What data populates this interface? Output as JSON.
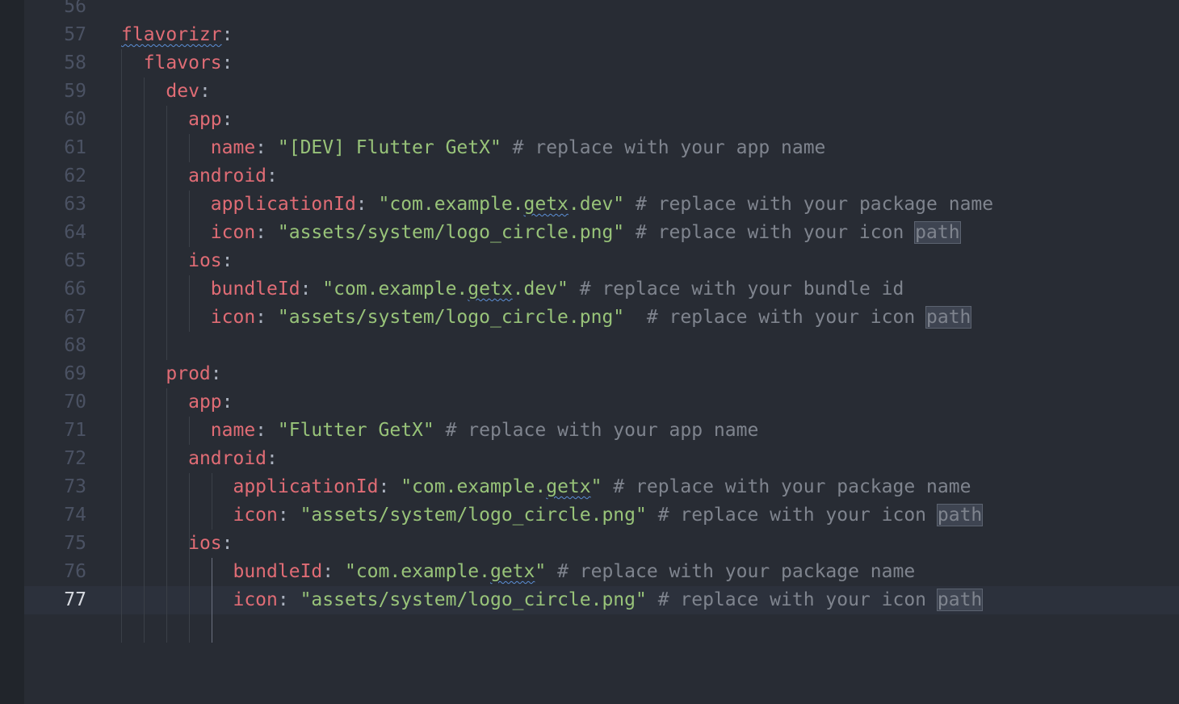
{
  "editor": {
    "lines": [
      {
        "num": "56",
        "tokens": []
      },
      {
        "num": "57",
        "tokens": [
          [
            "key squiggle",
            "flavorizr"
          ],
          [
            "punct",
            ":"
          ]
        ]
      },
      {
        "num": "58",
        "tokens": [
          [
            "",
            "  "
          ],
          [
            "key",
            "flavors"
          ],
          [
            "punct",
            ":"
          ]
        ]
      },
      {
        "num": "59",
        "tokens": [
          [
            "",
            "    "
          ],
          [
            "key",
            "dev"
          ],
          [
            "punct",
            ":"
          ]
        ]
      },
      {
        "num": "60",
        "tokens": [
          [
            "",
            "      "
          ],
          [
            "key",
            "app"
          ],
          [
            "punct",
            ":"
          ]
        ]
      },
      {
        "num": "61",
        "tokens": [
          [
            "",
            "        "
          ],
          [
            "key",
            "name"
          ],
          [
            "punct",
            ": "
          ],
          [
            "str",
            "\"[DEV] Flutter GetX\""
          ],
          [
            "comment",
            " # replace with your app name"
          ]
        ]
      },
      {
        "num": "62",
        "tokens": [
          [
            "",
            "      "
          ],
          [
            "key",
            "android"
          ],
          [
            "punct",
            ":"
          ]
        ]
      },
      {
        "num": "63",
        "tokens": [
          [
            "",
            "        "
          ],
          [
            "key",
            "applicationId"
          ],
          [
            "punct",
            ": "
          ],
          [
            "str",
            "\"com.example."
          ],
          [
            "str squiggle",
            "getx"
          ],
          [
            "str",
            ".dev\""
          ],
          [
            "comment",
            " # replace with your package name"
          ]
        ]
      },
      {
        "num": "64",
        "tokens": [
          [
            "",
            "        "
          ],
          [
            "key",
            "icon"
          ],
          [
            "punct",
            ": "
          ],
          [
            "str",
            "\"assets/system/logo_circle.png\""
          ],
          [
            "comment",
            " # replace with your icon "
          ],
          [
            "comment hl",
            "path"
          ]
        ]
      },
      {
        "num": "65",
        "tokens": [
          [
            "",
            "      "
          ],
          [
            "key",
            "ios"
          ],
          [
            "punct",
            ":"
          ]
        ]
      },
      {
        "num": "66",
        "tokens": [
          [
            "",
            "        "
          ],
          [
            "key",
            "bundleId"
          ],
          [
            "punct",
            ": "
          ],
          [
            "str",
            "\"com.example."
          ],
          [
            "str squiggle",
            "getx"
          ],
          [
            "str",
            ".dev\""
          ],
          [
            "comment",
            " # replace with your bundle id"
          ]
        ]
      },
      {
        "num": "67",
        "tokens": [
          [
            "",
            "        "
          ],
          [
            "key",
            "icon"
          ],
          [
            "punct",
            ": "
          ],
          [
            "str",
            "\"assets/system/logo_circle.png\""
          ],
          [
            "comment",
            "  # replace with your icon "
          ],
          [
            "comment hl",
            "path"
          ]
        ]
      },
      {
        "num": "68",
        "tokens": []
      },
      {
        "num": "69",
        "tokens": [
          [
            "",
            "    "
          ],
          [
            "key",
            "prod"
          ],
          [
            "punct",
            ":"
          ]
        ]
      },
      {
        "num": "70",
        "tokens": [
          [
            "",
            "      "
          ],
          [
            "key",
            "app"
          ],
          [
            "punct",
            ":"
          ]
        ]
      },
      {
        "num": "71",
        "tokens": [
          [
            "",
            "        "
          ],
          [
            "key",
            "name"
          ],
          [
            "punct",
            ": "
          ],
          [
            "str",
            "\"Flutter GetX\""
          ],
          [
            "comment",
            " # replace with your app name"
          ]
        ]
      },
      {
        "num": "72",
        "tokens": [
          [
            "",
            "      "
          ],
          [
            "key",
            "android"
          ],
          [
            "punct",
            ":"
          ]
        ]
      },
      {
        "num": "73",
        "tokens": [
          [
            "",
            "          "
          ],
          [
            "key",
            "applicationId"
          ],
          [
            "punct",
            ": "
          ],
          [
            "str",
            "\"com.example."
          ],
          [
            "str squiggle",
            "getx"
          ],
          [
            "str",
            "\""
          ],
          [
            "comment",
            " # replace with your package name"
          ]
        ]
      },
      {
        "num": "74",
        "tokens": [
          [
            "",
            "          "
          ],
          [
            "key",
            "icon"
          ],
          [
            "punct",
            ": "
          ],
          [
            "str",
            "\"assets/system/logo_circle.png\""
          ],
          [
            "comment",
            " # replace with your icon "
          ],
          [
            "comment hl",
            "path"
          ]
        ]
      },
      {
        "num": "75",
        "tokens": [
          [
            "",
            "      "
          ],
          [
            "key",
            "ios"
          ],
          [
            "punct",
            ":"
          ]
        ]
      },
      {
        "num": "76",
        "tokens": [
          [
            "",
            "          "
          ],
          [
            "key",
            "bundleId"
          ],
          [
            "punct",
            ": "
          ],
          [
            "str",
            "\"com.example."
          ],
          [
            "str squiggle",
            "getx"
          ],
          [
            "str",
            "\""
          ],
          [
            "comment",
            " # replace with your package name"
          ]
        ]
      },
      {
        "num": "77",
        "tokens": [
          [
            "",
            "          "
          ],
          [
            "key",
            "icon"
          ],
          [
            "punct",
            ": "
          ],
          [
            "str",
            "\"assets/system/logo_circle.png\""
          ],
          [
            "comment",
            " # replace with your icon "
          ],
          [
            "comment hl",
            "path"
          ]
        ],
        "current": true
      }
    ]
  },
  "colors": {
    "background": "#282c34",
    "key": "#e06c75",
    "string": "#98c379",
    "comment": "#7f848e",
    "line_number": "#4b5263",
    "current_line": "#2c313c"
  }
}
